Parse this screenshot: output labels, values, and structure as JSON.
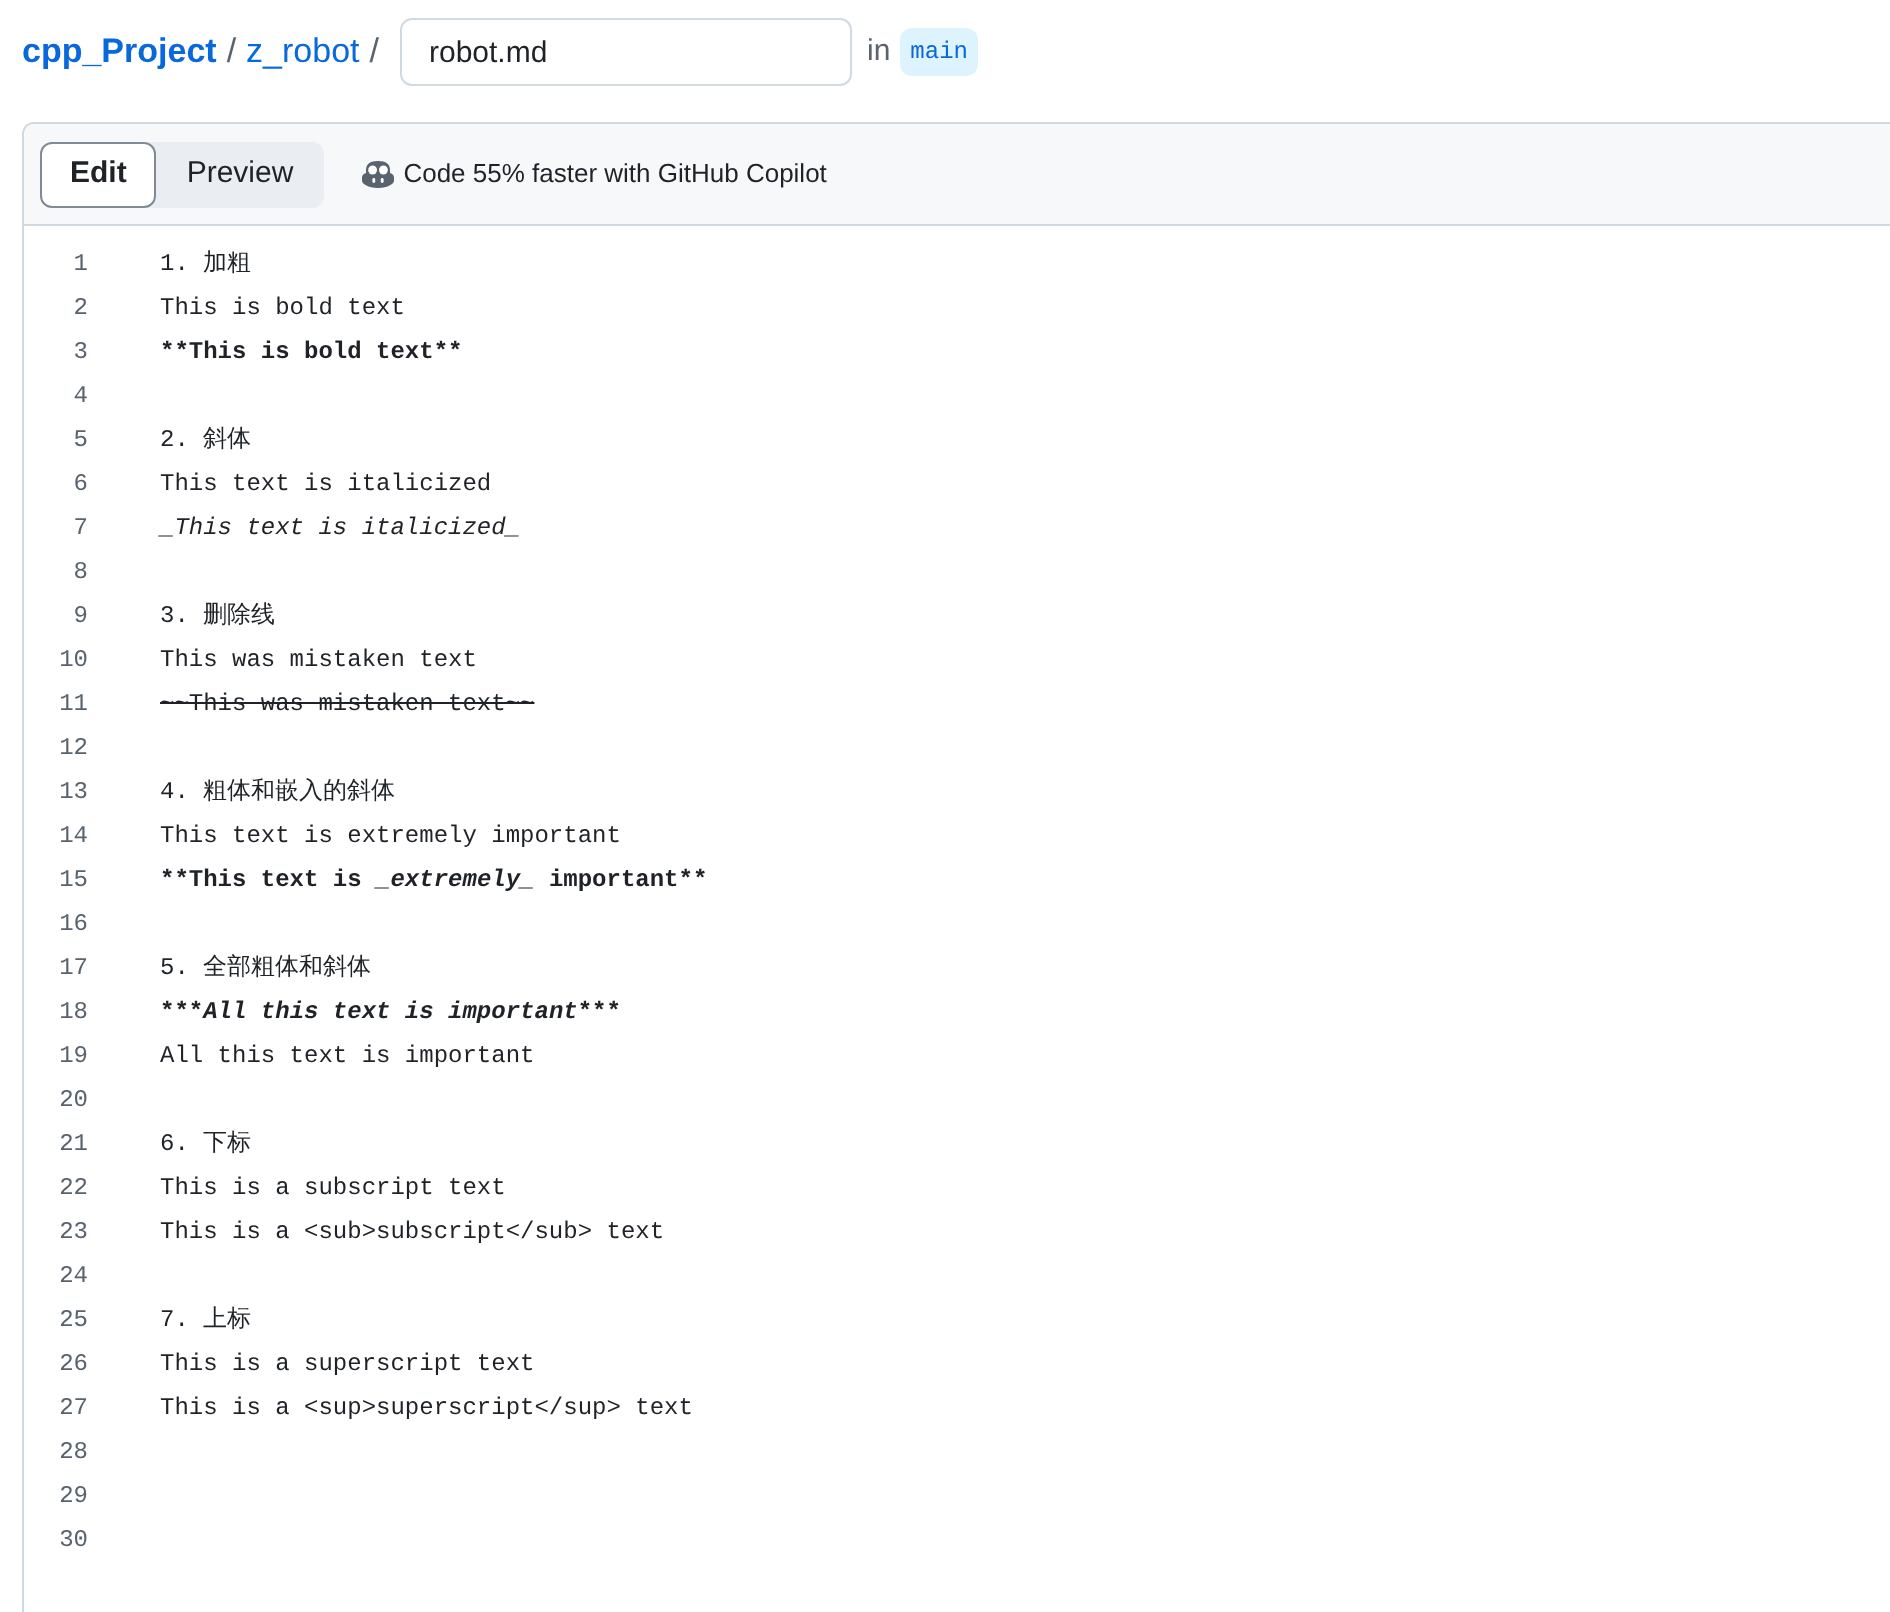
{
  "breadcrumb": {
    "repo": "cpp_Project",
    "separator_1": "/",
    "folder": "z_robot",
    "separator_2": "/"
  },
  "filename": {
    "value": "robot.md"
  },
  "branch": {
    "prefix": "in",
    "name": "main"
  },
  "tabs": [
    {
      "label": "Edit",
      "selected": true
    },
    {
      "label": "Preview",
      "selected": false
    }
  ],
  "copilot_promo": "Code 55% faster with GitHub Copilot",
  "editor": {
    "lines": [
      {
        "number": "1",
        "segments": [
          {
            "text": "1. 加粗",
            "kind": "plain"
          }
        ]
      },
      {
        "number": "2",
        "segments": [
          {
            "text": "This is bold text",
            "kind": "plain"
          }
        ]
      },
      {
        "number": "3",
        "segments": [
          {
            "text": "**This is bold text**",
            "kind": "bold"
          }
        ]
      },
      {
        "number": "4"
      },
      {
        "number": "5",
        "segments": [
          {
            "text": "2. 斜体",
            "kind": "plain"
          }
        ]
      },
      {
        "number": "6",
        "segments": [
          {
            "text": "This text is italicized",
            "kind": "plain"
          }
        ]
      },
      {
        "number": "7",
        "segments": [
          {
            "text": "_This text is italicized_",
            "kind": "italic"
          }
        ]
      },
      {
        "number": "8"
      },
      {
        "number": "9",
        "segments": [
          {
            "text": "3. 删除线",
            "kind": "plain"
          }
        ]
      },
      {
        "number": "10",
        "segments": [
          {
            "text": "This was mistaken text",
            "kind": "plain"
          }
        ]
      },
      {
        "number": "11",
        "segments": [
          {
            "text": "~~This was mistaken text~~",
            "kind": "strike"
          }
        ]
      },
      {
        "number": "12"
      },
      {
        "number": "13",
        "segments": [
          {
            "text": "4. 粗体和嵌入的斜体",
            "kind": "plain"
          }
        ]
      },
      {
        "number": "14",
        "segments": [
          {
            "text": "This text is extremely important",
            "kind": "plain"
          }
        ]
      },
      {
        "number": "15",
        "segments": [
          {
            "text": "**This text is ",
            "kind": "bold"
          },
          {
            "text": "_extremely_",
            "kind": "bold-italic"
          },
          {
            "text": " important**",
            "kind": "bold"
          }
        ]
      },
      {
        "number": "16"
      },
      {
        "number": "17",
        "segments": [
          {
            "text": "5. 全部粗体和斜体",
            "kind": "plain"
          }
        ]
      },
      {
        "number": "18",
        "segments": [
          {
            "text": "***",
            "kind": "bold"
          },
          {
            "text": "All this text is important",
            "kind": "bold-italic"
          },
          {
            "text": "***",
            "kind": "bold"
          }
        ]
      },
      {
        "number": "19",
        "segments": [
          {
            "text": "All this text is important",
            "kind": "plain"
          }
        ]
      },
      {
        "number": "20"
      },
      {
        "number": "21",
        "segments": [
          {
            "text": "6. 下标",
            "kind": "plain"
          }
        ]
      },
      {
        "number": "22",
        "segments": [
          {
            "text": "This is a subscript text",
            "kind": "plain"
          }
        ]
      },
      {
        "number": "23",
        "segments": [
          {
            "text": "This is a <sub>subscript</sub> text",
            "kind": "plain"
          }
        ]
      },
      {
        "number": "24"
      },
      {
        "number": "25",
        "segments": [
          {
            "text": "7. 上标",
            "kind": "plain"
          }
        ]
      },
      {
        "number": "26",
        "segments": [
          {
            "text": "This is a superscript text",
            "kind": "plain"
          }
        ]
      },
      {
        "number": "27",
        "segments": [
          {
            "text": "This is a <sup>superscript</sup> text",
            "kind": "plain"
          }
        ]
      },
      {
        "number": "28"
      },
      {
        "number": "29"
      },
      {
        "number": "30"
      }
    ]
  }
}
